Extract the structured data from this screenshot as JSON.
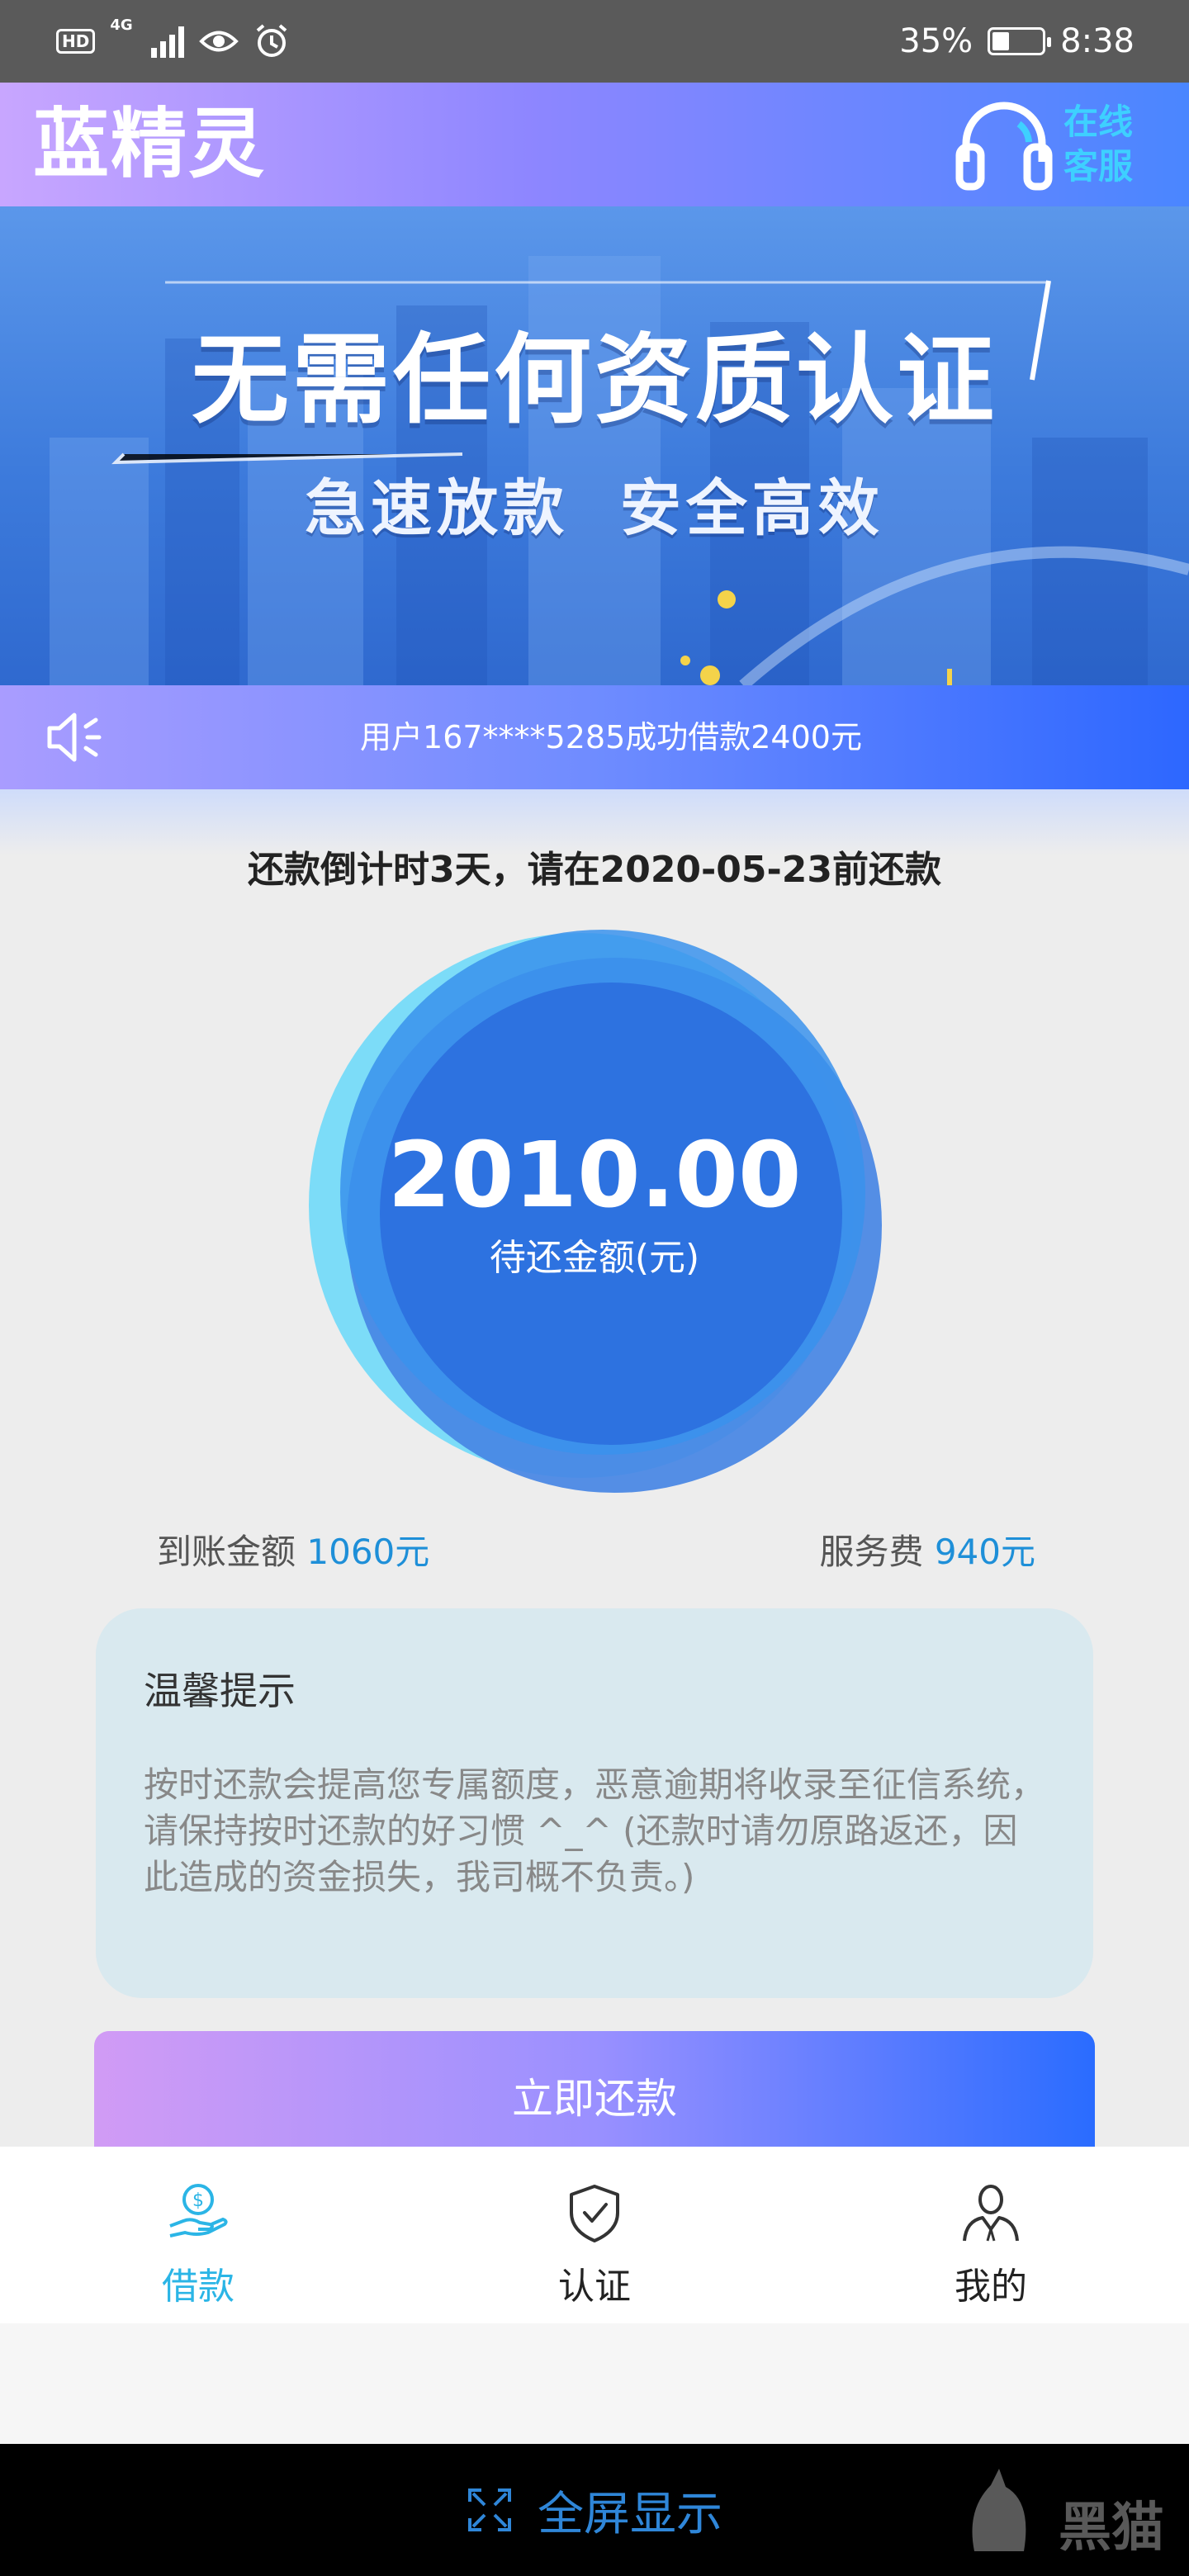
{
  "status_bar": {
    "network_badge": "HD",
    "network_type": "4G",
    "battery_percent": "35%",
    "time": "8:38",
    "battery_level": 0.35
  },
  "header": {
    "app_title": "蓝精灵",
    "customer_service_label": "在线客服",
    "accent_color": "#3ed0ff"
  },
  "banner": {
    "headline": "无需任何资质认证",
    "subline": "急速放款 安全高效"
  },
  "notice": {
    "text": "用户167****5285成功借款2400元"
  },
  "repayment": {
    "countdown": "还款倒计时3天，请在2020-05-23前还款",
    "amount": "2010.00",
    "amount_label": "待还金额(元)",
    "received_label": "到账金额",
    "received_value": "1060元",
    "fee_label": "服务费",
    "fee_value": "940元"
  },
  "tips": {
    "title": "温馨提示",
    "body": "按时还款会提高您专属额度，恶意逾期将收录至征信系统，请保持按时还款的好习惯 ^_^ (还款时请勿原路返还，因此造成的资金损失，我司概不负责。)"
  },
  "pay_button": {
    "label": "立即还款"
  },
  "tabs": [
    {
      "label": "借款",
      "icon": "loan-icon",
      "active": true
    },
    {
      "label": "认证",
      "icon": "shield-check-icon",
      "active": false
    },
    {
      "label": "我的",
      "icon": "user-icon",
      "active": false
    }
  ],
  "system_nav": {
    "fullscreen_label": "全屏显示",
    "watermark": "黑猫"
  }
}
